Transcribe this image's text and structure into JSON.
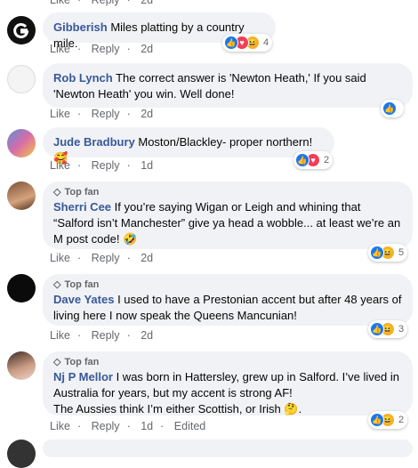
{
  "actions": {
    "like": "Like",
    "reply": "Reply",
    "sep": "·",
    "edited": "Edited"
  },
  "badge_label": "Top fan",
  "comments": [
    {
      "name": "",
      "text": "",
      "time": "",
      "reactions": ""
    },
    {
      "name": "Gibberish",
      "text": "Miles platting by a country mile.",
      "time": "2d",
      "reactions": "4"
    },
    {
      "name": "Rob Lynch",
      "text": "The correct answer is 'Newton Heath,' If you said 'Newton Heath' you win. Well done!",
      "time": "2d",
      "reactions": ""
    },
    {
      "name": "Jude Bradbury",
      "text": "Moston/Blackley- proper northern!🥰",
      "time": "1d",
      "reactions": "2"
    },
    {
      "name": "Sherri Cee",
      "text": "If you’re saying Wigan or Leigh and whining that “Salford isn’t Manchester” give ya head a wobble... at least we’re an M post code! 🤣",
      "time": "2d",
      "reactions": "5"
    },
    {
      "name": "Dave Yates",
      "text": "I used to have a Prestonian accent but after 48 years of living here I now speak the Queens Mancunian!",
      "time": "2d",
      "reactions": "3"
    },
    {
      "name": "Nj P Mellor",
      "text": "I was born in Hattersley, grew up in Salford. I’ve lived in Australia for years, but my accent is strong AF!",
      "text2": "The Aussies think I’m either Scottish, or Irish 🤔.",
      "time": "1d",
      "reactions": "2"
    }
  ],
  "colors": {
    "name": "#385898",
    "bubble": "#f0f2f5",
    "meta": "#65676b",
    "like": "#1877f2",
    "love": "#f33e58",
    "haha": "#f7b125"
  }
}
